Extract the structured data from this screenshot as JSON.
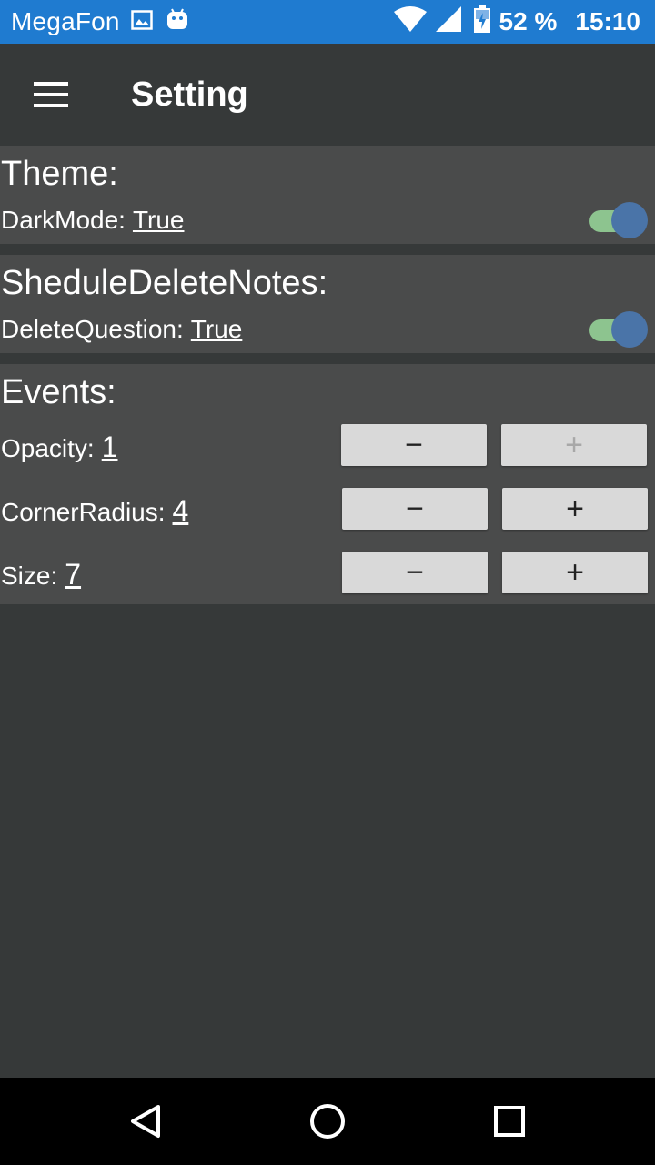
{
  "status_bar": {
    "carrier": "MegaFon",
    "battery_percent": "52 %",
    "time": "15:10",
    "icons": [
      "image-icon",
      "android-icon",
      "wifi-icon",
      "signal-icon",
      "battery-charging-icon"
    ]
  },
  "toolbar": {
    "title": "Setting",
    "menu_icon": "hamburger-menu-icon"
  },
  "theme": {
    "title": "Theme:",
    "dark_mode_label": "DarkMode:",
    "dark_mode_value": "True",
    "dark_mode_on": true
  },
  "notes": {
    "title": "SheduleDeleteNotes:",
    "delete_question_label": "DeleteQuestion:",
    "delete_question_value": "True",
    "delete_question_on": true
  },
  "events": {
    "title": "Events:",
    "rows": [
      {
        "label": "Opacity:",
        "value": "1",
        "minus": "−",
        "plus": "+",
        "plus_enabled": false
      },
      {
        "label": "CornerRadius:",
        "value": "4",
        "minus": "−",
        "plus": "+",
        "plus_enabled": true
      },
      {
        "label": "Size:",
        "value": "7",
        "minus": "−",
        "plus": "+",
        "plus_enabled": true
      }
    ]
  },
  "nav": {
    "back": "back-triangle-icon",
    "home": "home-circle-icon",
    "recents": "recents-square-icon"
  },
  "colors": {
    "status_bar": "#1f7bd0",
    "background": "#363939",
    "panel": "#4a4b4b",
    "switch_track": "#8dc48f",
    "switch_thumb": "#4a74a8",
    "button": "#d9d9d9"
  }
}
